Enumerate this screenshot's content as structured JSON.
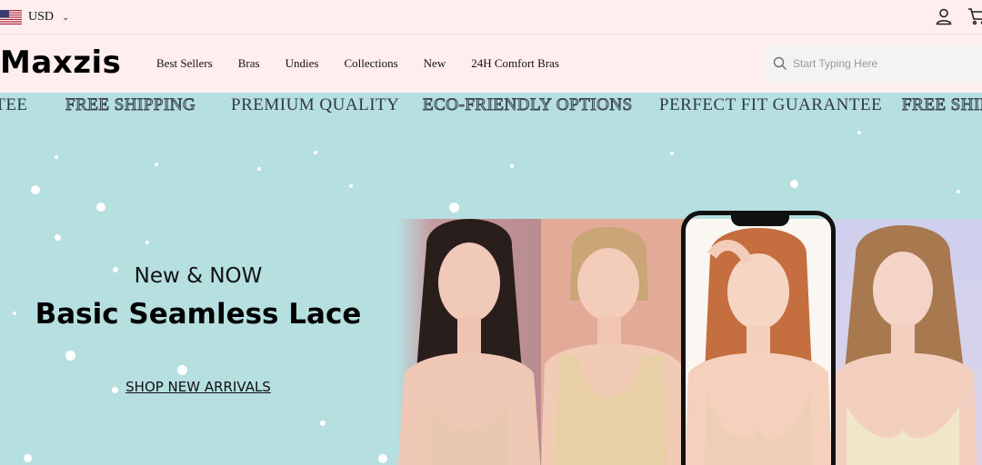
{
  "topbar": {
    "currency": "USD",
    "currency_flag_icon": "us-flag-icon",
    "account_icon": "user-icon",
    "cart_icon": "shopping-cart-icon"
  },
  "header": {
    "logo": "Maxzis",
    "nav": [
      "Best Sellers",
      "Bras",
      "Undies",
      "Collections",
      "New",
      "24H Comfort Bras"
    ],
    "search_placeholder": "Start Typing Here"
  },
  "marquee": [
    "NTEE",
    "FREE SHIPPING",
    "PREMIUM QUALITY",
    "ECO-FRIENDLY OPTIONS",
    "PERFECT FIT GUARANTEE",
    "FREE SHIPPING"
  ],
  "hero": {
    "subtitle": "New & NOW",
    "title": "Basic Seamless Lace",
    "cta": "SHOP NEW ARRIVALS",
    "background": "#b6dfe0"
  },
  "colors": {
    "topbar_bg": "#ffeeee",
    "hero_bg": "#b6dfe0",
    "text": "#111111"
  }
}
